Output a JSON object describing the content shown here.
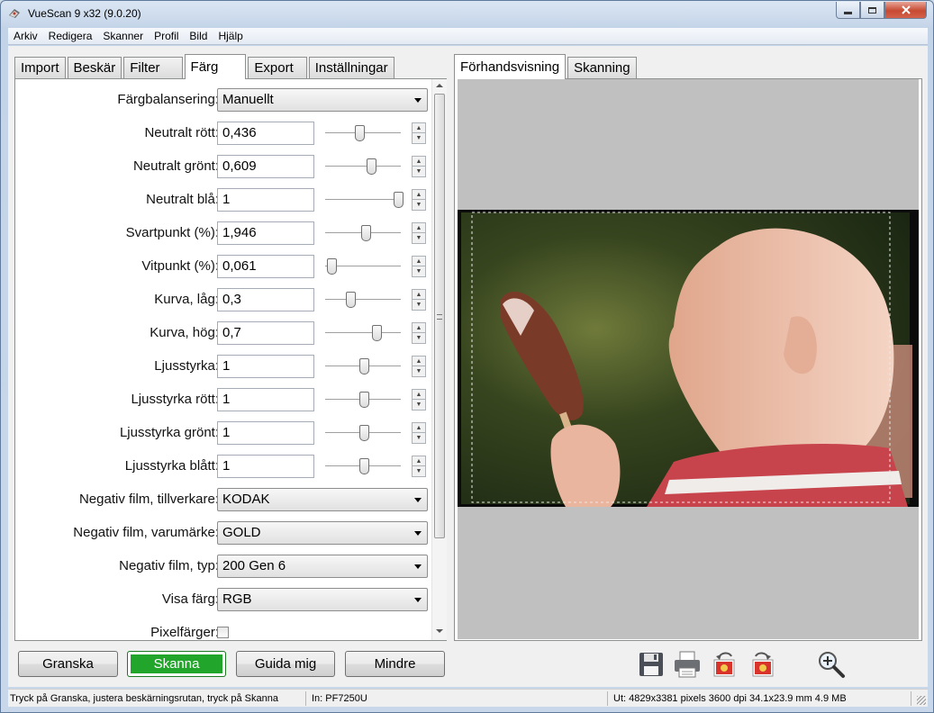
{
  "window": {
    "title": "VueScan 9 x32 (9.0.20)"
  },
  "menu": [
    "Arkiv",
    "Redigera",
    "Skanner",
    "Profil",
    "Bild",
    "Hjälp"
  ],
  "left_tabs": [
    "Import",
    "Beskär",
    "Filter",
    "Färg",
    "Export",
    "Inställningar"
  ],
  "left_active_tab": "Färg",
  "right_tabs": [
    "Förhandsvisning",
    "Skanning"
  ],
  "right_active_tab": "Förhandsvisning",
  "color_settings": {
    "color_balance": {
      "label": "Färgbalansering:",
      "value": "Manuellt"
    },
    "numeric_rows": [
      {
        "label": "Neutralt rött:",
        "value": "0,436",
        "slider_fraction": 0.45
      },
      {
        "label": "Neutralt grönt:",
        "value": "0,609",
        "slider_fraction": 0.61
      },
      {
        "label": "Neutralt blå:",
        "value": "1",
        "slider_fraction": 0.96
      },
      {
        "label": "Svartpunkt (%):",
        "value": "1,946",
        "slider_fraction": 0.54
      },
      {
        "label": "Vitpunkt (%):",
        "value": "0,061",
        "slider_fraction": 0.08
      },
      {
        "label": "Kurva, låg:",
        "value": "0,3",
        "slider_fraction": 0.33
      },
      {
        "label": "Kurva, hög:",
        "value": "0,7",
        "slider_fraction": 0.68
      },
      {
        "label": "Ljusstyrka:",
        "value": "1",
        "slider_fraction": 0.51
      },
      {
        "label": "Ljusstyrka rött:",
        "value": "1",
        "slider_fraction": 0.51
      },
      {
        "label": "Ljusstyrka grönt:",
        "value": "1",
        "slider_fraction": 0.51
      },
      {
        "label": "Ljusstyrka blått:",
        "value": "1",
        "slider_fraction": 0.51
      }
    ],
    "film_make": {
      "label": "Negativ film, tillverkare:",
      "value": "KODAK"
    },
    "film_brand": {
      "label": "Negativ film, varumärke:",
      "value": "GOLD"
    },
    "film_type": {
      "label": "Negativ film, typ:",
      "value": "200 Gen 6"
    },
    "show_color": {
      "label": "Visa färg:",
      "value": "RGB"
    },
    "pixel_colors": {
      "label": "Pixelfärger:",
      "checked": false
    }
  },
  "buttons": {
    "preview": "Granska",
    "scan": "Skanna",
    "guide": "Guida mig",
    "less": "Mindre"
  },
  "toolbar_icons": [
    "save-icon",
    "print-icon",
    "rotate-left-icon",
    "rotate-right-icon",
    "zoom-in-icon"
  ],
  "status": {
    "hint": "Tryck på Granska, justera beskärningsrutan, tryck på Skanna",
    "input": "In: PF7250U",
    "output": "Ut: 4829x3381 pixels 3600 dpi 34.1x23.9 mm 4.9 MB"
  },
  "colors": {
    "scan_button": "#22a52b",
    "preview_background": "#c0c0c0"
  }
}
